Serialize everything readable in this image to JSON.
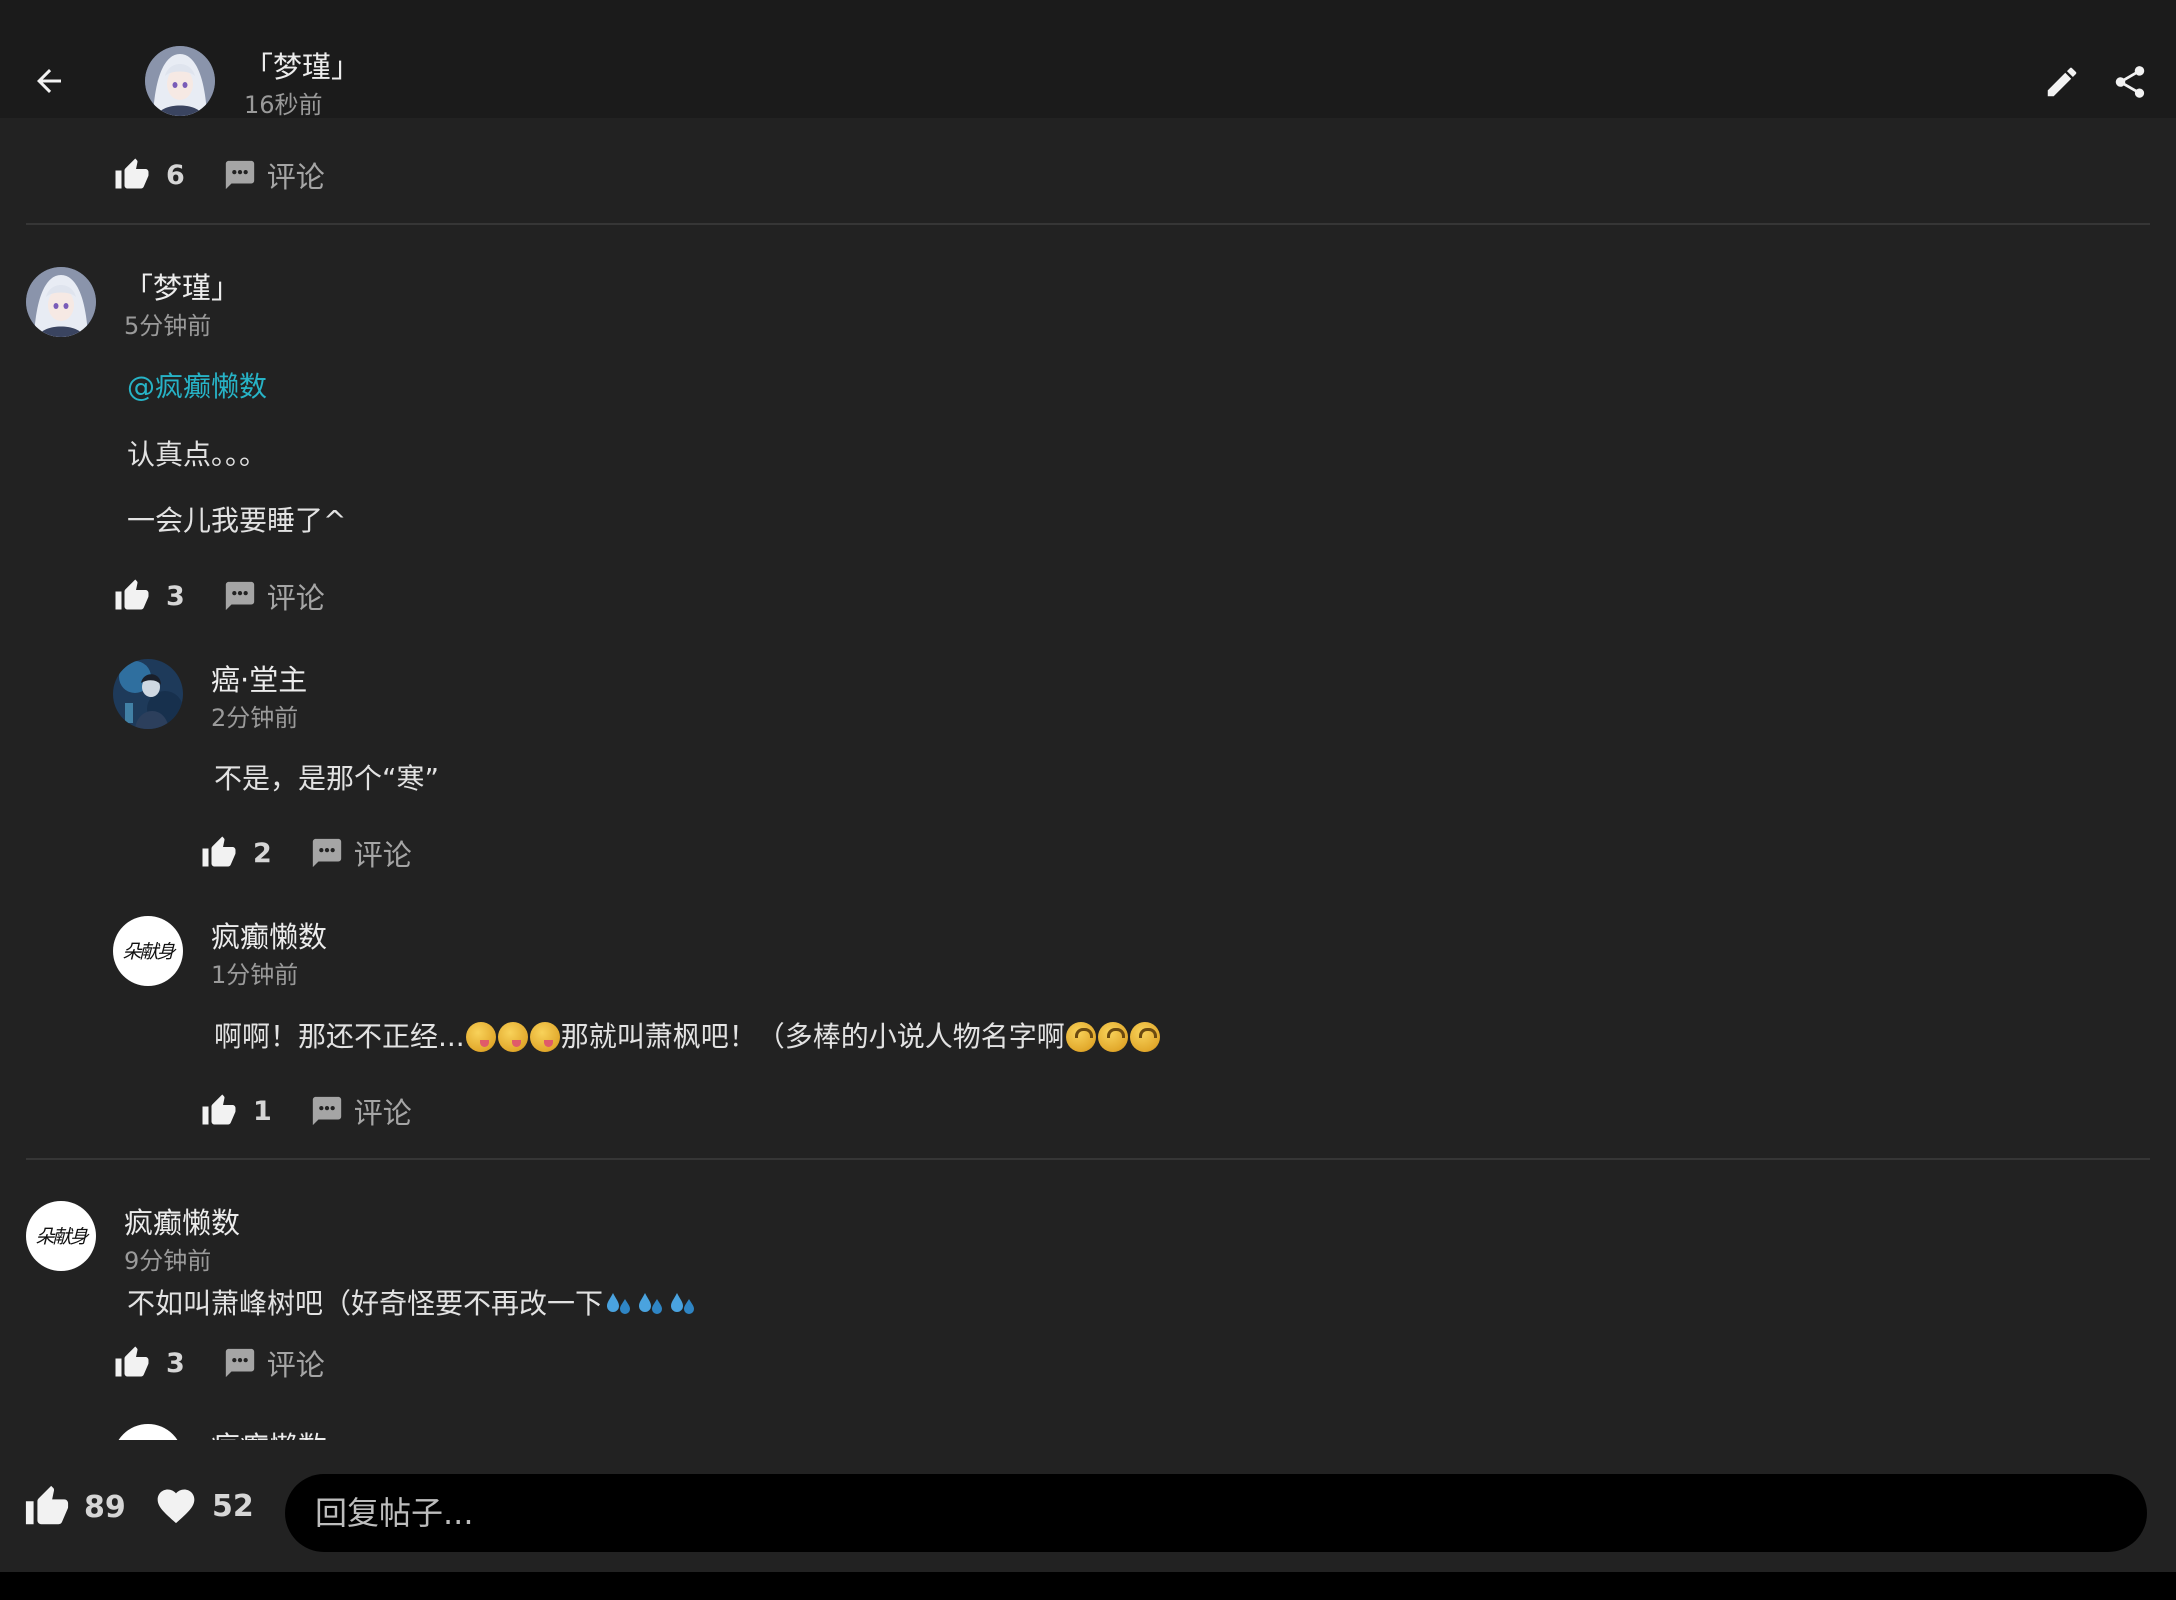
{
  "header": {
    "author": "「梦瑾」",
    "time": "16秒前",
    "icons": {
      "back": "back-arrow-icon",
      "edit": "pencil-icon",
      "share": "share-icon"
    }
  },
  "post_actions": {
    "likes": "6",
    "comment_label": "评论"
  },
  "comments": [
    {
      "author": "「梦瑾」",
      "time": "5分钟前",
      "mention": "@疯癫懒数",
      "lines": [
        "认真点。。。",
        "一会儿我要睡了^"
      ],
      "likes": "3",
      "comment_label": "评论",
      "replies": [
        {
          "author": "癌·堂主",
          "time": "2分钟前",
          "text": "不是，是那个“寒”",
          "likes": "2",
          "comment_label": "评论"
        },
        {
          "author": "疯癫懒数",
          "time": "1分钟前",
          "text_before": "啊啊！那还不正经...",
          "text_middle": "那就叫萧枫吧！（多棒的小说人物名字啊",
          "likes": "1",
          "comment_label": "评论"
        }
      ]
    },
    {
      "author": "疯癫懒数",
      "time": "9分钟前",
      "text": "不如叫萧峰树吧（好奇怪要不再改一下",
      "likes": "3",
      "comment_label": "评论"
    }
  ],
  "partial_next_author": "疯癫懒数",
  "bottom_bar": {
    "likes": "89",
    "favorites": "52",
    "reply_placeholder": "回复帖子..."
  },
  "colors": {
    "mention": "#27b3c6",
    "background": "#222222",
    "topbar": "#1b1b1b"
  }
}
